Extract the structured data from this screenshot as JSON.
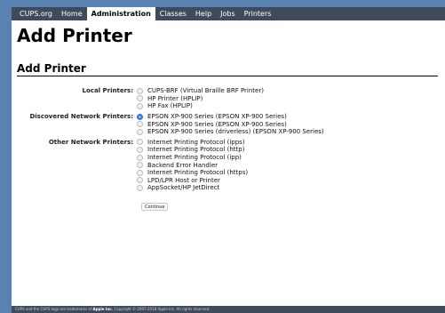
{
  "nav": {
    "items": [
      {
        "label": "CUPS.org"
      },
      {
        "label": "Home"
      },
      {
        "label": "Administration"
      },
      {
        "label": "Classes"
      },
      {
        "label": "Help"
      },
      {
        "label": "Jobs"
      },
      {
        "label": "Printers"
      }
    ],
    "active_index": 2
  },
  "page": {
    "title": "Add Printer",
    "section_title": "Add Printer"
  },
  "groups": [
    {
      "label": "Local Printers:",
      "options": [
        {
          "label": "CUPS-BRF (Virtual Braille BRF Printer)",
          "checked": false
        },
        {
          "label": "HP Printer (HPLIP)",
          "checked": false
        },
        {
          "label": "HP Fax (HPLIP)",
          "checked": false
        }
      ]
    },
    {
      "label": "Discovered Network Printers:",
      "options": [
        {
          "label": "EPSON XP-900 Series (EPSON XP-900 Series)",
          "checked": true
        },
        {
          "label": "EPSON XP-900 Series (EPSON XP-900 Series)",
          "checked": false
        },
        {
          "label": "EPSON XP-900 Series (driverless) (EPSON XP-900 Series)",
          "checked": false
        }
      ]
    },
    {
      "label": "Other Network Printers:",
      "options": [
        {
          "label": "Internet Printing Protocol (ipps)",
          "checked": false
        },
        {
          "label": "Internet Printing Protocol (http)",
          "checked": false
        },
        {
          "label": "Internet Printing Protocol (ipp)",
          "checked": false
        },
        {
          "label": "Backend Error Handler",
          "checked": false
        },
        {
          "label": "Internet Printing Protocol (https)",
          "checked": false
        },
        {
          "label": "LPD/LPR Host or Printer",
          "checked": false
        },
        {
          "label": "AppSocket/HP JetDirect",
          "checked": false
        }
      ]
    }
  ],
  "continue_label": "Continue",
  "footer": {
    "prefix": "CUPS and the CUPS logo are trademarks of ",
    "company": "Apple Inc.",
    "suffix": " Copyright © 2007-2018 Apple Inc. All rights reserved."
  },
  "colors": {
    "nav_bg": "#3f4b5c",
    "outer_bg": "#5a82b0",
    "radio_selected": "#2f6fd6"
  }
}
